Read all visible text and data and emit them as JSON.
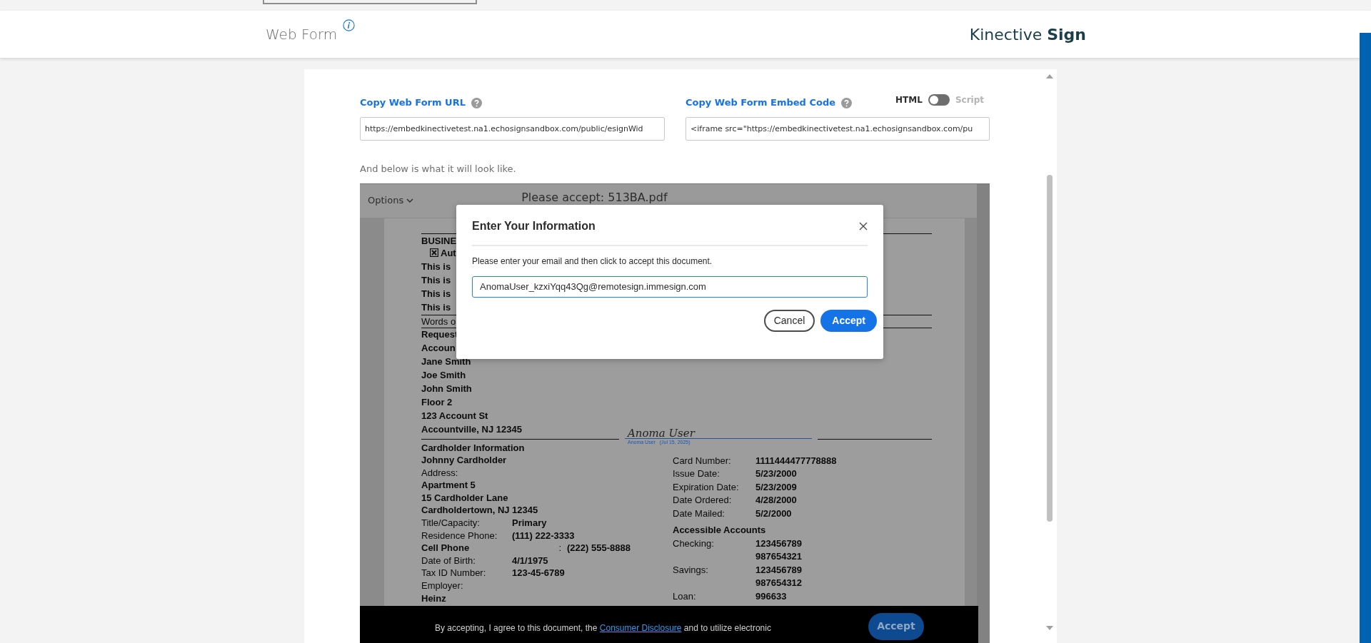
{
  "header": {
    "title": "Web Form",
    "brand": "Kinective **Sign**"
  },
  "url_field": {
    "label": "Copy Web Form URL",
    "value": "https://embedkinectivetest.na1.echosignsandbox.com/public/esignWid"
  },
  "embed_field": {
    "label": "Copy Web Form Embed Code",
    "value": "<iframe src=\"https://embedkinectivetest.na1.echosignsandbox.com/pu",
    "toggle": {
      "left": "HTML",
      "right": "Script",
      "on": false
    }
  },
  "preview_caption": "And below is what it will look like.",
  "preview": {
    "options": "Options",
    "title": "Please accept: 513BA.pdf",
    "top_lines": [
      {
        "kind": "heading",
        "text": "BUSINE"
      },
      {
        "kind": "checkbox",
        "text": "Aut",
        "checked": true
      },
      {
        "kind": "bold",
        "text": "This is"
      },
      {
        "kind": "bold",
        "text": "This is"
      },
      {
        "kind": "bold",
        "text": "This is"
      },
      {
        "kind": "bold",
        "text": "This is"
      },
      {
        "kind": "plain",
        "text": "Words o"
      },
      {
        "kind": "bold",
        "text": "Request"
      },
      {
        "kind": "bold",
        "text": "Accoun"
      },
      {
        "kind": "bold",
        "text": "Jane Smith"
      },
      {
        "kind": "bold",
        "text": "Joe Smith"
      },
      {
        "kind": "bold",
        "text": "John Smith"
      },
      {
        "kind": "bold",
        "text": "Floor 2"
      },
      {
        "kind": "bold",
        "text": "123 Account St"
      },
      {
        "kind": "bold",
        "text": "Accountville, NJ 12345"
      }
    ],
    "signature": {
      "name": "Anoma User",
      "caption": "Anoma User",
      "date": "(Jul 15, 2025)"
    },
    "left_lines": [
      {
        "kind": "heading",
        "text": "Cardholder Information"
      },
      {
        "kind": "bold",
        "text": "Johnny Cardholder"
      },
      {
        "kind": "plain",
        "text": "Address:"
      },
      {
        "kind": "bold",
        "text": "Apartment 5"
      },
      {
        "kind": "bold",
        "text": "15 Cardholder Lane"
      },
      {
        "kind": "bold",
        "text": "Cardholdertown, NJ 12345"
      },
      {
        "kind": "pair",
        "label": "Title/Capacity:",
        "label_bold": false,
        "value": "Primary"
      },
      {
        "kind": "pair",
        "label": "Residence Phone:",
        "label_bold": false,
        "value": "(111) 222-3333"
      },
      {
        "kind": "pair",
        "label": "Cell Phone",
        "label_bold": true,
        "separator": ":",
        "value": "(222) 555-8888"
      },
      {
        "kind": "pair",
        "label": "Date of Birth:",
        "label_bold": false,
        "value": "4/1/1975"
      },
      {
        "kind": "pair",
        "label": "Tax ID Number:",
        "label_bold": false,
        "value": "123-45-6789"
      },
      {
        "kind": "plain",
        "text": "Employer:"
      },
      {
        "kind": "bold",
        "text": "Heinz"
      }
    ],
    "right_lines": [
      {
        "kind": "pair",
        "label": "Card Number:",
        "values": [
          "1111444477778888"
        ]
      },
      {
        "kind": "pair",
        "label": "Issue Date:",
        "values": [
          "5/23/2000"
        ]
      },
      {
        "kind": "pair",
        "label": "Expiration Date:",
        "values": [
          "5/23/2009"
        ]
      },
      {
        "kind": "pair",
        "label": "Date Ordered:",
        "values": [
          "4/28/2000"
        ]
      },
      {
        "kind": "pair",
        "label": "Date Mailed:",
        "values": [
          "5/2/2000"
        ]
      },
      {
        "kind": "heading",
        "text": "Accessible Accounts"
      },
      {
        "kind": "pair",
        "label": "Checking:",
        "values": [
          "123456789",
          "987654321"
        ]
      },
      {
        "kind": "pair",
        "label": "Savings:",
        "values": [
          "123456789",
          "987654312"
        ]
      },
      {
        "kind": "pair",
        "label": "Loan:",
        "values": [
          "996633"
        ]
      }
    ],
    "footer": {
      "before": "By accepting, I agree to this document, the ",
      "link": "Consumer Disclosure",
      "after": " and to utilize electronic",
      "button": "Accept"
    }
  },
  "dialog": {
    "title": "Enter Your Information",
    "message": "Please enter your email and then click to accept this document.",
    "email": "AnomaUser_kzxiYqq43Qg@remotesign.immesign.com",
    "cancel": "Cancel",
    "accept": "Accept"
  }
}
